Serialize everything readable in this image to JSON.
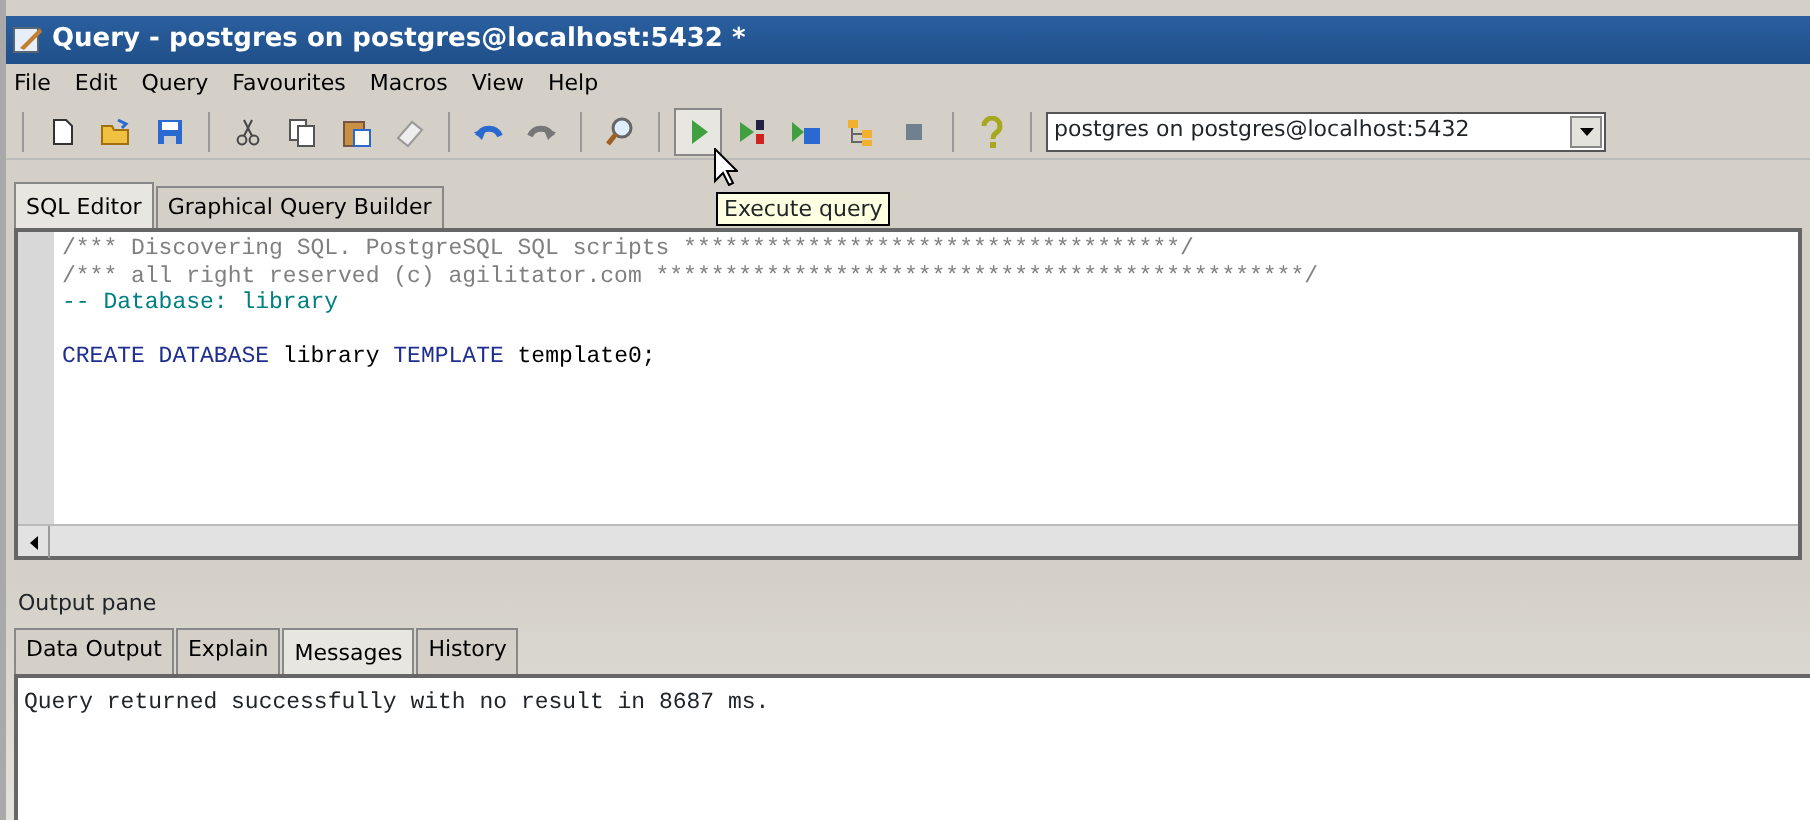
{
  "window": {
    "title": "Query - postgres on postgres@localhost:5432 *"
  },
  "menu": [
    {
      "label": "File"
    },
    {
      "label": "Edit"
    },
    {
      "label": "Query"
    },
    {
      "label": "Favourites"
    },
    {
      "label": "Macros"
    },
    {
      "label": "View"
    },
    {
      "label": "Help"
    }
  ],
  "connection": {
    "value": "postgres on postgres@localhost:5432"
  },
  "tooltip": "Execute query",
  "editor_tabs": [
    {
      "label": "SQL Editor",
      "selected": true
    },
    {
      "label": "Graphical Query Builder",
      "selected": false
    }
  ],
  "editor_lines": [
    [
      {
        "kind": "comment",
        "text": "/*** Discovering SQL. PostgreSQL SQL scripts ************************************/"
      }
    ],
    [
      {
        "kind": "comment",
        "text": "/*** all right reserved (c) agilitator.com ***********************************************/"
      }
    ],
    [
      {
        "kind": "line_comment",
        "text": "-- Database: library"
      }
    ],
    {
      "blank_line_before": true,
      "segments": [
        {
          "kind": "keyword",
          "text": "CREATE DATABASE"
        },
        {
          "kind": "plain",
          "text": " library "
        },
        {
          "kind": "keyword",
          "text": "TEMPLATE"
        },
        {
          "kind": "plain",
          "text": " template0;"
        }
      ]
    }
  ],
  "output_pane": {
    "title": "Output pane",
    "tabs": [
      {
        "label": "Data Output",
        "selected": false
      },
      {
        "label": "Explain",
        "selected": false
      },
      {
        "label": "Messages",
        "selected": true
      },
      {
        "label": "History",
        "selected": false
      }
    ],
    "message": "Query returned successfully with no result in 8687 ms."
  }
}
